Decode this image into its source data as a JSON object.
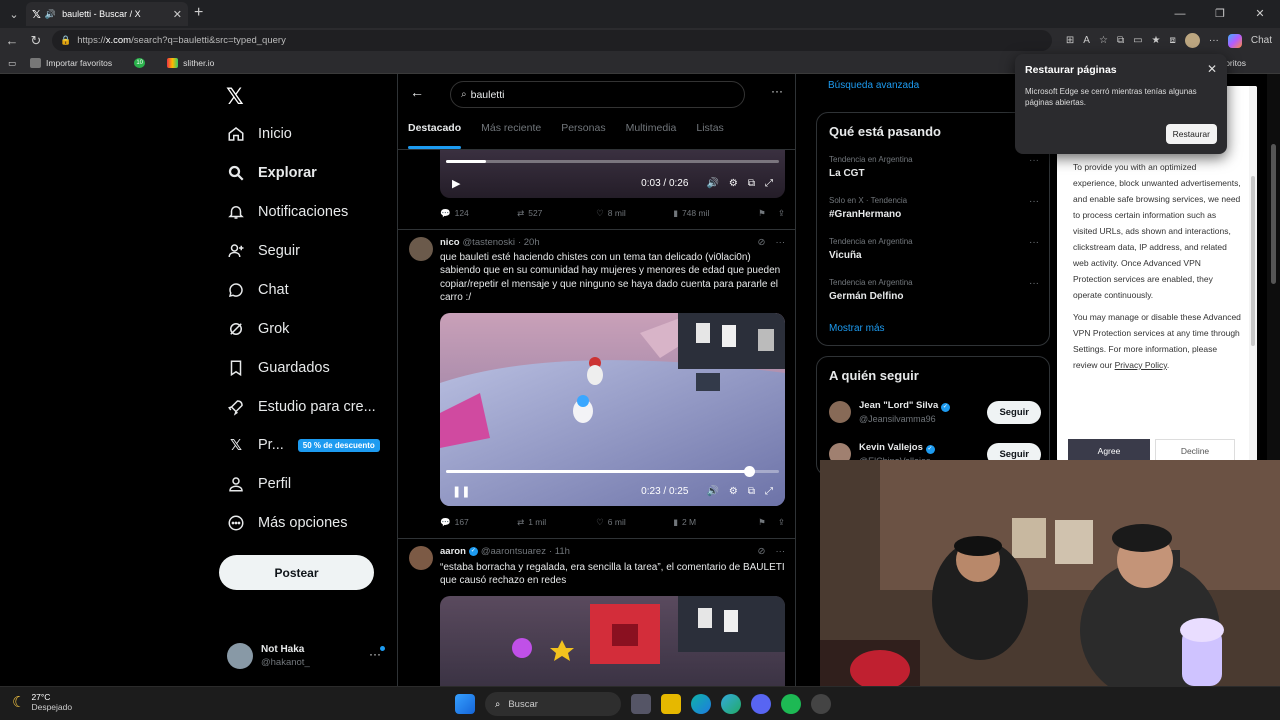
{
  "browser": {
    "tab_title": "bauletti - Buscar / X",
    "url_host": "x.com",
    "url_prefix": "https://",
    "url_rest": "/search?q=bauletti&src=typed_query",
    "favorites": [
      {
        "label": "Importar favoritos"
      },
      {
        "label": "10"
      },
      {
        "label": "slither.io"
      }
    ],
    "favorites_right": "Otros favoritos",
    "chat_label": "Chat"
  },
  "nav": {
    "items": [
      {
        "label": "Inicio",
        "icon": "home-icon"
      },
      {
        "label": "Explorar",
        "icon": "search-icon"
      },
      {
        "label": "Notificaciones",
        "icon": "bell-icon"
      },
      {
        "label": "Seguir",
        "icon": "add-user-icon"
      },
      {
        "label": "Chat",
        "icon": "chat-icon"
      },
      {
        "label": "Grok",
        "icon": "grok-icon"
      },
      {
        "label": "Guardados",
        "icon": "bookmark-icon"
      },
      {
        "label": "Estudio para cre...",
        "icon": "rocket-icon"
      },
      {
        "label": "Pr...",
        "icon": "x-logo-icon"
      },
      {
        "label": "Perfil",
        "icon": "person-icon"
      },
      {
        "label": "Más opciones",
        "icon": "more-circle-icon"
      }
    ],
    "promo_badge": "50 % de descuento",
    "post_button": "Postear"
  },
  "profile": {
    "name": "Not Haka",
    "handle": "@hakanot_"
  },
  "search": {
    "query": "bauletti",
    "tabs": [
      "Destacado",
      "Más reciente",
      "Personas",
      "Multimedia",
      "Listas"
    ]
  },
  "tweets": [
    {
      "video_time": "0:03 / 0:26",
      "progress": 0.12,
      "stats": {
        "replies": "124",
        "reposts": "527",
        "likes": "8 mil",
        "views": "748 mil"
      }
    },
    {
      "name": "nico",
      "handle": "@tastenoski",
      "time": "· 20h",
      "text": "que bauleti esté haciendo chistes con un tema tan delicado (vi0laci0n) sabiendo que en su comunidad hay mujeres y menores de edad que pueden copiar/repetir el mensaje y que ninguno se haya dado cuenta para pararle el carro :/",
      "video_time": "0:23 / 0:25",
      "progress": 0.91,
      "stats": {
        "replies": "167",
        "reposts": "1 mil",
        "likes": "6 mil",
        "views": "2 M"
      }
    },
    {
      "name": "aaron",
      "handle": "@aarontsuarez",
      "time": "· 11h",
      "text": "“estaba borracha y regalada, era sencilla la tarea”, el comentario de BAULETI que causó rechazo en redes"
    }
  ],
  "right": {
    "advanced_search": "Búsqueda avanzada",
    "trends_title": "Qué está pasando",
    "trends": [
      {
        "category": "Tendencia en Argentina",
        "title": "La CGT"
      },
      {
        "category": "Solo en X · Tendencia",
        "title": "#GranHermano"
      },
      {
        "category": "Tendencia en Argentina",
        "title": "Vicuña"
      },
      {
        "category": "Tendencia en Argentina",
        "title": "Germán Delfino"
      }
    ],
    "show_more": "Mostrar más",
    "follow_title": "A quién seguir",
    "follow": [
      {
        "name": "Jean \"Lord\" Silva",
        "handle": "@Jeansilvamma96",
        "button": "Seguir"
      },
      {
        "name": "Kevin Vallejos",
        "handle": "@ElChinoVallejos",
        "button": "Seguir"
      }
    ]
  },
  "edge_popup": {
    "title": "Restaurar páginas",
    "body": "Microsoft Edge se cerró mientras tenías algunas páginas abiertas.",
    "button": "Restaurar"
  },
  "vpn": {
    "p1": "To provide you with an optimized experience, block unwanted advertisements, and enable safe browsing services, we need to process certain information such as visited URLs, ads shown and interactions, clickstream data, IP address, and related web activity. Once Advanced VPN Protection services are enabled, they operate continuously.",
    "p2": "You may manage or disable these Advanced VPN Protection services at any time through Settings. For more information, please review our",
    "link": "Privacy Policy",
    "agree": "Agree",
    "decline": "Decline"
  },
  "taskbar": {
    "temp": "27°C",
    "condition": "Despejado",
    "search": "Buscar"
  },
  "colors": {
    "accent": "#1d9bf0",
    "bg": "#000000",
    "border": "#2f3336"
  }
}
